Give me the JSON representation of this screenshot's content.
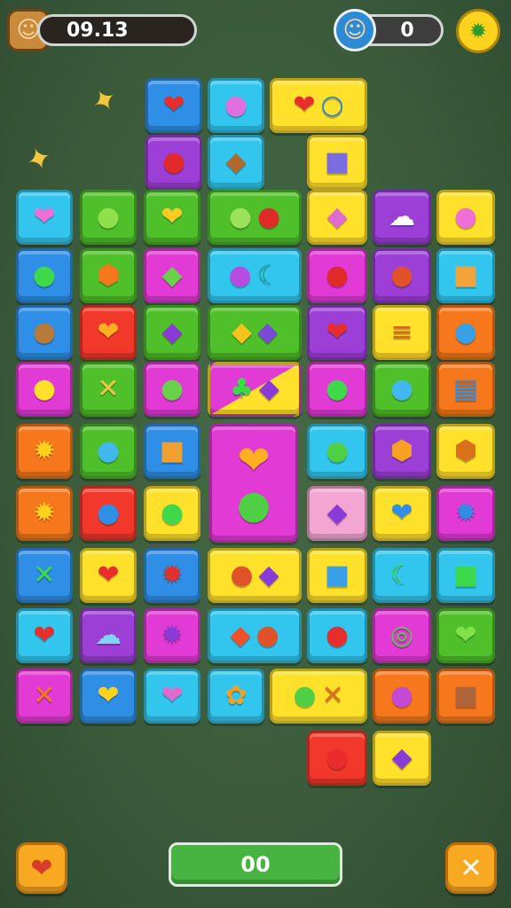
{
  "hud": {
    "timer": "09.13",
    "score": "0",
    "left_avatar_icon": "cowboy-avatar-icon",
    "right_avatar_icon": "glasses-avatar-icon",
    "settings_icon": "settings-icon"
  },
  "bottom": {
    "progress_label": "00",
    "left_button_icon": "heart-icon",
    "right_button_icon": "close-icon"
  },
  "floaters": [
    {
      "icon": "bee-icon",
      "glyph": "✦"
    },
    {
      "icon": "bee-icon",
      "glyph": "✦"
    }
  ],
  "colors": {
    "red": "#f2382a",
    "blue": "#2f8ee6",
    "cyan": "#32c6ee",
    "green": "#4fbf2a",
    "yellow": "#ffe02a",
    "purple": "#9b3fd6",
    "magenta": "#e23ad4",
    "orange": "#f7781c",
    "pink": "#f3a6d2"
  },
  "tiles": [
    {
      "id": "t01",
      "color": "blue",
      "icons": [
        {
          "n": "heart-icon",
          "g": "❤",
          "c": "#e92c2c"
        }
      ]
    },
    {
      "id": "t02",
      "color": "cyan",
      "icons": [
        {
          "n": "lollipop-icon",
          "g": "●",
          "c": "#e070e0"
        }
      ]
    },
    {
      "id": "t03",
      "color": "yellow",
      "icons": [
        {
          "n": "heart-icon",
          "g": "❤",
          "c": "#e92c2c"
        },
        {
          "n": "magnifier-icon",
          "g": "○",
          "c": "#2a7fd4"
        }
      ]
    },
    {
      "id": "t04",
      "color": "purple",
      "icons": [
        {
          "n": "apple-icon",
          "g": "●",
          "c": "#e02a2a"
        }
      ]
    },
    {
      "id": "t05",
      "color": "cyan",
      "icons": [
        {
          "n": "cookie-icon",
          "g": "◆",
          "c": "#b06a2e"
        }
      ]
    },
    {
      "id": "t06",
      "color": "yellow",
      "icons": [
        {
          "n": "candy-icon",
          "g": "■",
          "c": "#7a6de0"
        }
      ]
    },
    {
      "id": "t07",
      "color": "cyan",
      "icons": [
        {
          "n": "heart-icon",
          "g": "❤",
          "c": "#f06fd6"
        }
      ]
    },
    {
      "id": "t08",
      "color": "green",
      "icons": [
        {
          "n": "leaf-icon",
          "g": "●",
          "c": "#8fe04a"
        }
      ]
    },
    {
      "id": "t09",
      "color": "green",
      "icons": [
        {
          "n": "heart-icon",
          "g": "❤",
          "c": "#ffcb24"
        }
      ]
    },
    {
      "id": "t10",
      "color": "green",
      "icons": [
        {
          "n": "leaf-icon",
          "g": "●",
          "c": "#9be25a"
        },
        {
          "n": "apple-icon",
          "g": "●",
          "c": "#e02a2a"
        }
      ]
    },
    {
      "id": "t11",
      "color": "yellow",
      "icons": [
        {
          "n": "gift-icon",
          "g": "◆",
          "c": "#e06ad0"
        }
      ]
    },
    {
      "id": "t12",
      "color": "purple",
      "icons": [
        {
          "n": "cloud-icon",
          "g": "☁",
          "c": "#ffffff"
        }
      ]
    },
    {
      "id": "t13",
      "color": "yellow",
      "icons": [
        {
          "n": "face-icon",
          "g": "●",
          "c": "#f06fd6"
        }
      ]
    },
    {
      "id": "t14",
      "color": "blue",
      "icons": [
        {
          "n": "balloon-icon",
          "g": "●",
          "c": "#3ed94a"
        }
      ]
    },
    {
      "id": "t15",
      "color": "green",
      "icons": [
        {
          "n": "face-icon",
          "g": "⬢",
          "c": "#f7781c"
        }
      ]
    },
    {
      "id": "t16",
      "color": "magenta",
      "icons": [
        {
          "n": "leaf-icon",
          "g": "◆",
          "c": "#6ad24a"
        }
      ]
    },
    {
      "id": "t17",
      "color": "cyan",
      "icons": [
        {
          "n": "lollipop-icon",
          "g": "●",
          "c": "#b84be0"
        },
        {
          "n": "moon-icon",
          "g": "☾",
          "c": "#1a9f8f"
        }
      ]
    },
    {
      "id": "t18",
      "color": "magenta",
      "icons": [
        {
          "n": "apple-icon",
          "g": "●",
          "c": "#e02a2a"
        }
      ]
    },
    {
      "id": "t19",
      "color": "purple",
      "icons": [
        {
          "n": "candy-icon",
          "g": "●",
          "c": "#e0522a"
        }
      ]
    },
    {
      "id": "t20",
      "color": "cyan",
      "icons": [
        {
          "n": "fries-icon",
          "g": "■",
          "c": "#f2a43a"
        }
      ]
    },
    {
      "id": "t21",
      "color": "blue",
      "icons": [
        {
          "n": "face-icon",
          "g": "●",
          "c": "#b87a3a"
        }
      ]
    },
    {
      "id": "t22",
      "color": "red",
      "icons": [
        {
          "n": "heart-icon",
          "g": "❤",
          "c": "#ffb020"
        }
      ]
    },
    {
      "id": "t23",
      "color": "green",
      "icons": [
        {
          "n": "eggplant-icon",
          "g": "◆",
          "c": "#8a3ad6"
        }
      ]
    },
    {
      "id": "t24",
      "color": "green",
      "icons": [
        {
          "n": "banana-icon",
          "g": "◆",
          "c": "#f7c21c"
        },
        {
          "n": "feather-icon",
          "g": "◆",
          "c": "#7a4ad6"
        }
      ]
    },
    {
      "id": "t25",
      "color": "purple",
      "icons": [
        {
          "n": "heart-icon",
          "g": "❤",
          "c": "#e92c2c"
        }
      ]
    },
    {
      "id": "t26",
      "color": "yellow",
      "icons": [
        {
          "n": "burger-icon",
          "g": "≡",
          "c": "#d9611a"
        }
      ]
    },
    {
      "id": "t27",
      "color": "orange",
      "icons": [
        {
          "n": "candy-icon",
          "g": "●",
          "c": "#3aa0e6"
        }
      ]
    },
    {
      "id": "t28",
      "color": "magenta",
      "icons": [
        {
          "n": "face-icon",
          "g": "●",
          "c": "#ffe02a"
        }
      ]
    },
    {
      "id": "t29",
      "color": "green",
      "icons": [
        {
          "n": "cross-icon",
          "g": "✕",
          "c": "#f2c640"
        }
      ]
    },
    {
      "id": "t30",
      "color": "magenta",
      "icons": [
        {
          "n": "ball-icon",
          "g": "●",
          "c": "#6ad24a"
        }
      ]
    },
    {
      "id": "t31",
      "color": "yellow",
      "icons": [
        {
          "n": "broccoli-icon",
          "g": "♣",
          "c": "#3ed94a"
        },
        {
          "n": "eggplant-icon",
          "g": "◆",
          "c": "#8a3ad6"
        }
      ]
    },
    {
      "id": "t32",
      "color": "magenta",
      "icons": [
        {
          "n": "ball-icon",
          "g": "●",
          "c": "#3ed94a"
        }
      ]
    },
    {
      "id": "t33",
      "color": "green",
      "icons": [
        {
          "n": "face-icon",
          "g": "●",
          "c": "#42b8f0"
        }
      ]
    },
    {
      "id": "t34",
      "color": "orange",
      "icons": [
        {
          "n": "list-icon",
          "g": "▤",
          "c": "#2f8ee6"
        }
      ]
    },
    {
      "id": "t35",
      "color": "orange",
      "icons": [
        {
          "n": "sun-icon",
          "g": "✹",
          "c": "#ffd21e"
        }
      ]
    },
    {
      "id": "t36",
      "color": "green",
      "icons": [
        {
          "n": "face-icon",
          "g": "●",
          "c": "#42b8f0"
        }
      ]
    },
    {
      "id": "t37",
      "color": "blue",
      "icons": [
        {
          "n": "toast-icon",
          "g": "■",
          "c": "#f0a030"
        }
      ]
    },
    {
      "id": "t38",
      "color": "magenta",
      "icons": [
        {
          "n": "heart-icon",
          "g": "❤",
          "c": "#ffb020"
        },
        {
          "n": "face-icon",
          "g": "●",
          "c": "#4fd044"
        }
      ]
    },
    {
      "id": "t39",
      "color": "cyan",
      "icons": [
        {
          "n": "face-icon",
          "g": "●",
          "c": "#4fd044"
        }
      ]
    },
    {
      "id": "t40",
      "color": "purple",
      "icons": [
        {
          "n": "face-icon",
          "g": "⬢",
          "c": "#f7a024"
        }
      ]
    },
    {
      "id": "t41",
      "color": "yellow",
      "icons": [
        {
          "n": "face-icon",
          "g": "⬢",
          "c": "#d9701a"
        }
      ]
    },
    {
      "id": "t42",
      "color": "orange",
      "icons": [
        {
          "n": "sun-icon",
          "g": "✹",
          "c": "#ffd21e"
        }
      ]
    },
    {
      "id": "t43",
      "color": "red",
      "icons": [
        {
          "n": "ball-icon",
          "g": "●",
          "c": "#2f8ee6"
        }
      ]
    },
    {
      "id": "t44",
      "color": "yellow",
      "icons": [
        {
          "n": "ball-icon",
          "g": "●",
          "c": "#3ed94a"
        }
      ]
    },
    {
      "id": "t45",
      "color": "pink",
      "icons": [
        {
          "n": "feather-icon",
          "g": "◆",
          "c": "#8a3ad6"
        }
      ]
    },
    {
      "id": "t46",
      "color": "yellow",
      "icons": [
        {
          "n": "heart-icon",
          "g": "❤",
          "c": "#2f8ee6"
        }
      ]
    },
    {
      "id": "t47",
      "color": "magenta",
      "icons": [
        {
          "n": "gear-icon",
          "g": "✹",
          "c": "#2f8ee6"
        }
      ]
    },
    {
      "id": "t48",
      "color": "blue",
      "icons": [
        {
          "n": "cross-icon",
          "g": "✕",
          "c": "#3ed94a"
        }
      ]
    },
    {
      "id": "t49",
      "color": "yellow",
      "icons": [
        {
          "n": "heart-icon",
          "g": "❤",
          "c": "#e92c2c"
        }
      ]
    },
    {
      "id": "t50",
      "color": "blue",
      "icons": [
        {
          "n": "virus-icon",
          "g": "✹",
          "c": "#e92c2c"
        }
      ]
    },
    {
      "id": "t51",
      "color": "yellow",
      "icons": [
        {
          "n": "apple-icon",
          "g": "●",
          "c": "#e0522a"
        },
        {
          "n": "feather-icon",
          "g": "◆",
          "c": "#8a3ad6"
        }
      ]
    },
    {
      "id": "t52",
      "color": "yellow",
      "icons": [
        {
          "n": "robot-icon",
          "g": "■",
          "c": "#3aa0e6"
        }
      ]
    },
    {
      "id": "t53",
      "color": "cyan",
      "icons": [
        {
          "n": "banana-icon",
          "g": "☾",
          "c": "#3ed94a"
        }
      ]
    },
    {
      "id": "t54",
      "color": "cyan",
      "icons": [
        {
          "n": "book-icon",
          "g": "■",
          "c": "#3ed94a"
        }
      ]
    },
    {
      "id": "t55",
      "color": "cyan",
      "icons": [
        {
          "n": "heart-icon",
          "g": "❤",
          "c": "#e92c2c"
        }
      ]
    },
    {
      "id": "t56",
      "color": "purple",
      "icons": [
        {
          "n": "cloud-icon",
          "g": "☁",
          "c": "#7fd4f5"
        }
      ]
    },
    {
      "id": "t57",
      "color": "magenta",
      "icons": [
        {
          "n": "splat-icon",
          "g": "✹",
          "c": "#8a3ad6"
        }
      ]
    },
    {
      "id": "t58",
      "color": "cyan",
      "icons": [
        {
          "n": "rocket-icon",
          "g": "◆",
          "c": "#f0502a"
        },
        {
          "n": "strawberry-icon",
          "g": "●",
          "c": "#e0522a"
        }
      ]
    },
    {
      "id": "t59",
      "color": "cyan",
      "icons": [
        {
          "n": "apple-icon",
          "g": "●",
          "c": "#e92c2c"
        }
      ]
    },
    {
      "id": "t60",
      "color": "magenta",
      "icons": [
        {
          "n": "ring-icon",
          "g": "◎",
          "c": "#4fd044"
        }
      ]
    },
    {
      "id": "t61",
      "color": "green",
      "icons": [
        {
          "n": "heart-icon",
          "g": "❤",
          "c": "#7fe24a"
        }
      ]
    },
    {
      "id": "t62",
      "color": "magenta",
      "icons": [
        {
          "n": "cross-icon",
          "g": "✕",
          "c": "#f7781c"
        }
      ]
    },
    {
      "id": "t63",
      "color": "blue",
      "icons": [
        {
          "n": "heart-icon",
          "g": "❤",
          "c": "#ffd21e"
        }
      ]
    },
    {
      "id": "t64",
      "color": "cyan",
      "icons": [
        {
          "n": "heart-icon",
          "g": "❤",
          "c": "#e06ad0"
        }
      ]
    },
    {
      "id": "t65",
      "color": "cyan",
      "icons": [
        {
          "n": "flower-icon",
          "g": "✿",
          "c": "#f7a024"
        }
      ]
    },
    {
      "id": "t66",
      "color": "yellow",
      "icons": [
        {
          "n": "leaf-icon",
          "g": "●",
          "c": "#4fd044"
        },
        {
          "n": "cross-icon",
          "g": "✕",
          "c": "#d9701a"
        }
      ]
    },
    {
      "id": "t67",
      "color": "orange",
      "icons": [
        {
          "n": "face-icon",
          "g": "●",
          "c": "#c44ad6"
        }
      ]
    },
    {
      "id": "t68",
      "color": "orange",
      "icons": [
        {
          "n": "slash-icon",
          "g": "■",
          "c": "#b0643a"
        }
      ]
    },
    {
      "id": "t69",
      "color": "red",
      "icons": [
        {
          "n": "apple-icon",
          "g": "●",
          "c": "#e92c2c"
        }
      ]
    },
    {
      "id": "t70",
      "color": "yellow",
      "icons": [
        {
          "n": "horn-icon",
          "g": "◆",
          "c": "#8a3ad6"
        }
      ]
    }
  ]
}
